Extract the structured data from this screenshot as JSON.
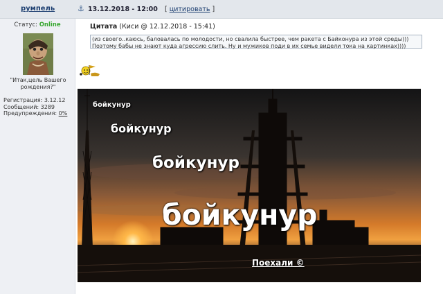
{
  "post": {
    "author": "румпель",
    "date": "13.12.2018 - 12:00",
    "cite_label": "цитировать",
    "cite_open": "[",
    "cite_close": "]"
  },
  "profile": {
    "status_label": "Статус:",
    "status_value": "Online",
    "signature": "\"Итак,цель Вашего рождения?\"",
    "reg_label": "Регистрация: 3.12.12",
    "messages_label": "Сообщений: 3289",
    "warnings_label": "Предупреждения:",
    "warnings_value": "0%"
  },
  "quote": {
    "label": "Цитата",
    "source": "(Киси @ 12.12.2018 - 15:41)",
    "line1": "(из своего..каюсь, баловалась по молодости, но свалила быстрее, чем ракета с Байконура из этой среды)))",
    "line2": "Поэтому бабы не знают куда агрессию слить. Ну и мужиков поди в их семье видели тока на картинках))))"
  },
  "image": {
    "texts": [
      "бойкунур",
      "бойкунур",
      "бойкунур",
      "бойкунур"
    ],
    "caption": "Поехали ©"
  },
  "colors": {
    "online": "#3aa832",
    "link": "#1c3e70",
    "header_bg": "#e3e7ec"
  }
}
